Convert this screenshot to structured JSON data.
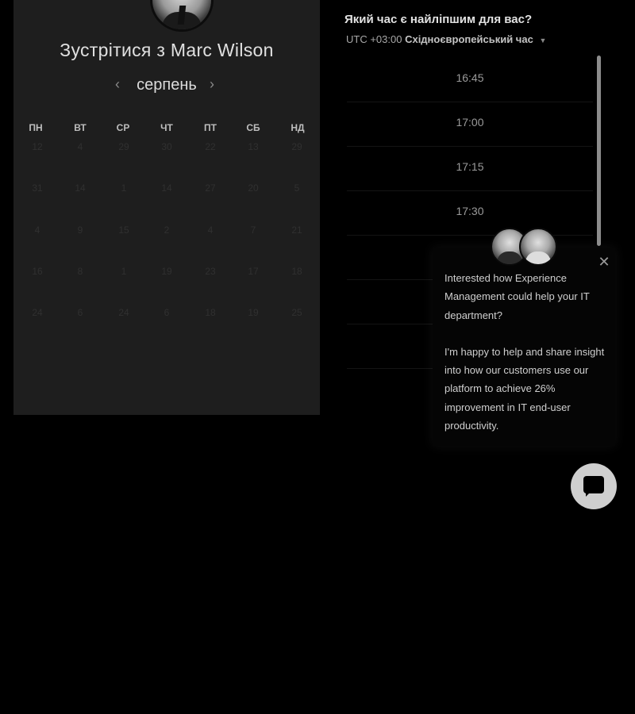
{
  "calendar": {
    "title": "Зустрітися з Marc Wilson",
    "month": "серпень",
    "prev_symbol": "‹",
    "next_symbol": "›",
    "weekdays": [
      "ПН",
      "ВТ",
      "СР",
      "ЧТ",
      "ПТ",
      "СБ",
      "НД"
    ],
    "weeks": [
      [
        "12",
        "4",
        "29",
        "30",
        "22",
        "13",
        "29"
      ],
      [
        "31",
        "14",
        "1",
        "14",
        "27",
        "20",
        "5"
      ],
      [
        "4",
        "9",
        "15",
        "2",
        "4",
        "7",
        "21"
      ],
      [
        "16",
        "8",
        "1",
        "19",
        "23",
        "17",
        "18"
      ],
      [
        "24",
        "6",
        "24",
        "6",
        "18",
        "19",
        "25"
      ]
    ]
  },
  "times": {
    "question": "Який час є найліпшим для вас?",
    "tz_offset": "UTC +03:00",
    "tz_name": "Східноєвропейський час",
    "slots": [
      "16:45",
      "17:00",
      "17:15",
      "17:30"
    ]
  },
  "chat": {
    "close_symbol": "✕",
    "message_1": "Interested how Experience Management could help your IT department?",
    "message_2": "I'm happy to help and share insight into how our customers use our platform to achieve 26% improvement in IT end-user productivity."
  },
  "colors": {
    "page_background": "#000000",
    "calendar_panel": "#1e1e1e",
    "launcher": "#cfcfcf"
  },
  "icons": {
    "prev": "chevron-left-icon",
    "next": "chevron-right-icon",
    "tz_dropdown": "caret-down-icon",
    "close": "close-icon",
    "launcher": "chat-bubble-icon"
  }
}
